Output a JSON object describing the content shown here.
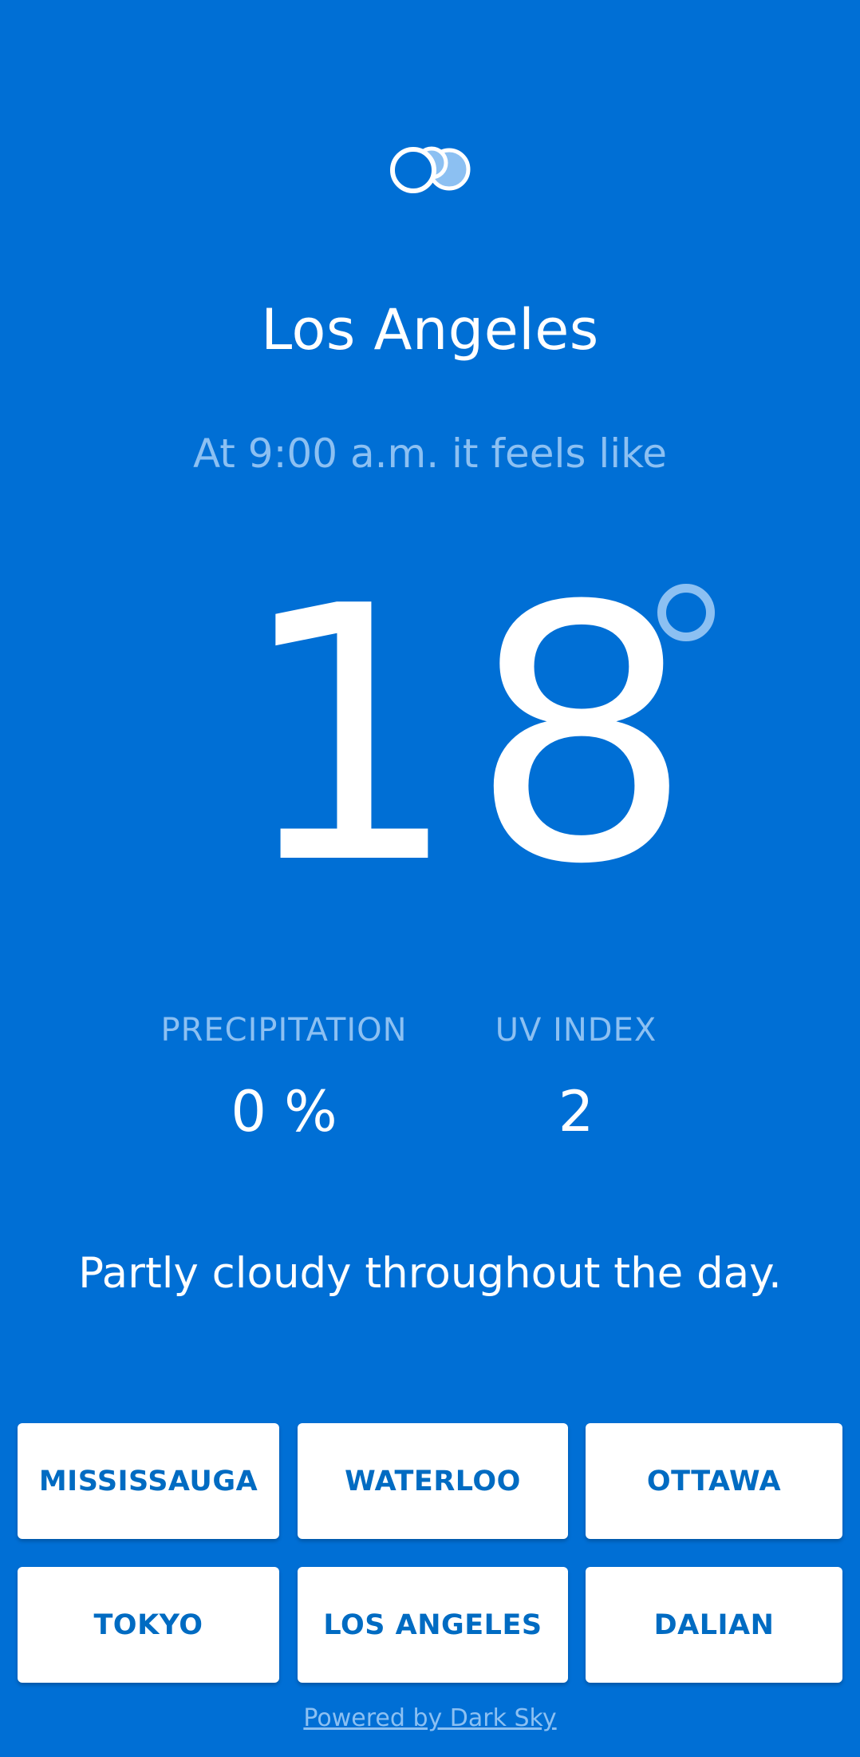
{
  "header": {
    "icon": "partly-cloudy-icon",
    "city": "Los Angeles",
    "feels_like_text": "At 9:00 a.m. it feels like"
  },
  "temperature": {
    "value": "18",
    "unit_symbol": "degree"
  },
  "stats": {
    "precipitation": {
      "label": "PRECIPITATION",
      "value": "0 %"
    },
    "uv_index": {
      "label": "UV INDEX",
      "value": "2"
    }
  },
  "summary": "Partly cloudy throughout the day.",
  "cities": [
    {
      "label": "MISSISSAUGA"
    },
    {
      "label": "WATERLOO"
    },
    {
      "label": "OTTAWA"
    },
    {
      "label": "TOKYO"
    },
    {
      "label": "LOS ANGELES"
    },
    {
      "label": "DALIAN"
    }
  ],
  "footer": {
    "powered_by": "Powered by Dark Sky"
  },
  "colors": {
    "background": "#006fd5",
    "accent_light": "#8cc0f2",
    "button_text": "#006bc2",
    "button_background": "#ffffff"
  }
}
